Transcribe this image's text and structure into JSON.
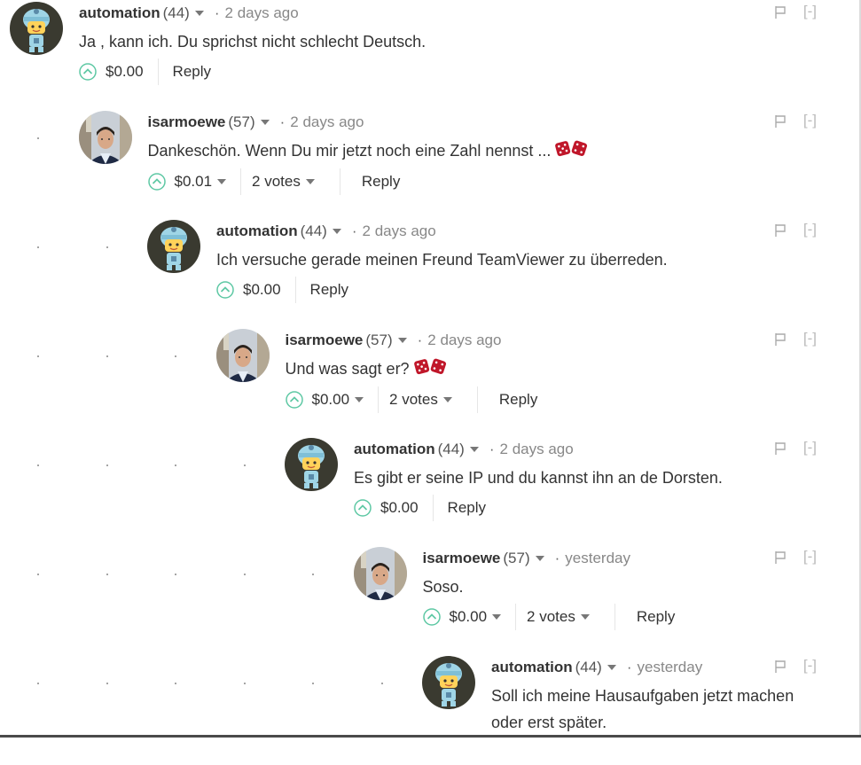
{
  "comments": [
    {
      "author": "automation",
      "rep": "(44)",
      "time": "2 days ago",
      "text": "Ja , kann ich. Du sprichst nicht schlecht Deutsch.",
      "payout": "$0.00",
      "votes": "",
      "reply": "Reply",
      "collapse": "[-]",
      "avatar": "robot-avatar",
      "dice": false
    },
    {
      "author": "isarmoewe",
      "rep": "(57)",
      "time": "2 days ago",
      "text": "Dankeschön. Wenn Du mir jetzt noch eine Zahl nennst ...",
      "payout": "$0.01",
      "votes": "2 votes",
      "reply": "Reply",
      "collapse": "[-]",
      "avatar": "person-avatar",
      "dice": true
    },
    {
      "author": "automation",
      "rep": "(44)",
      "time": "2 days ago",
      "text": "Ich versuche gerade meinen Freund TeamViewer zu überreden.",
      "payout": "$0.00",
      "votes": "",
      "reply": "Reply",
      "collapse": "[-]",
      "avatar": "robot-avatar",
      "dice": false
    },
    {
      "author": "isarmoewe",
      "rep": "(57)",
      "time": "2 days ago",
      "text": "Und was sagt er?",
      "payout": "$0.00",
      "votes": "2 votes",
      "reply": "Reply",
      "collapse": "[-]",
      "avatar": "person-avatar",
      "dice": true
    },
    {
      "author": "automation",
      "rep": "(44)",
      "time": "2 days ago",
      "text": "Es gibt er seine IP und du kannst ihn an de Dorsten.",
      "payout": "$0.00",
      "votes": "",
      "reply": "Reply",
      "collapse": "[-]",
      "avatar": "robot-avatar",
      "dice": false
    },
    {
      "author": "isarmoewe",
      "rep": "(57)",
      "time": "yesterday",
      "text": "Soso.",
      "payout": "$0.00",
      "votes": "2 votes",
      "reply": "Reply",
      "collapse": "[-]",
      "avatar": "person-avatar",
      "dice": false
    },
    {
      "author": "automation",
      "rep": "(44)",
      "time": "yesterday",
      "text": "Soll ich meine Hausaufgaben jetzt machen oder erst später.",
      "payout": "",
      "votes": "",
      "reply": "",
      "collapse": "[-]",
      "avatar": "robot-avatar",
      "dice": false
    }
  ],
  "colors": {
    "upvote": "#5ec8a4",
    "text": "#333333",
    "muted": "#888888",
    "dice": "#c0172a"
  }
}
